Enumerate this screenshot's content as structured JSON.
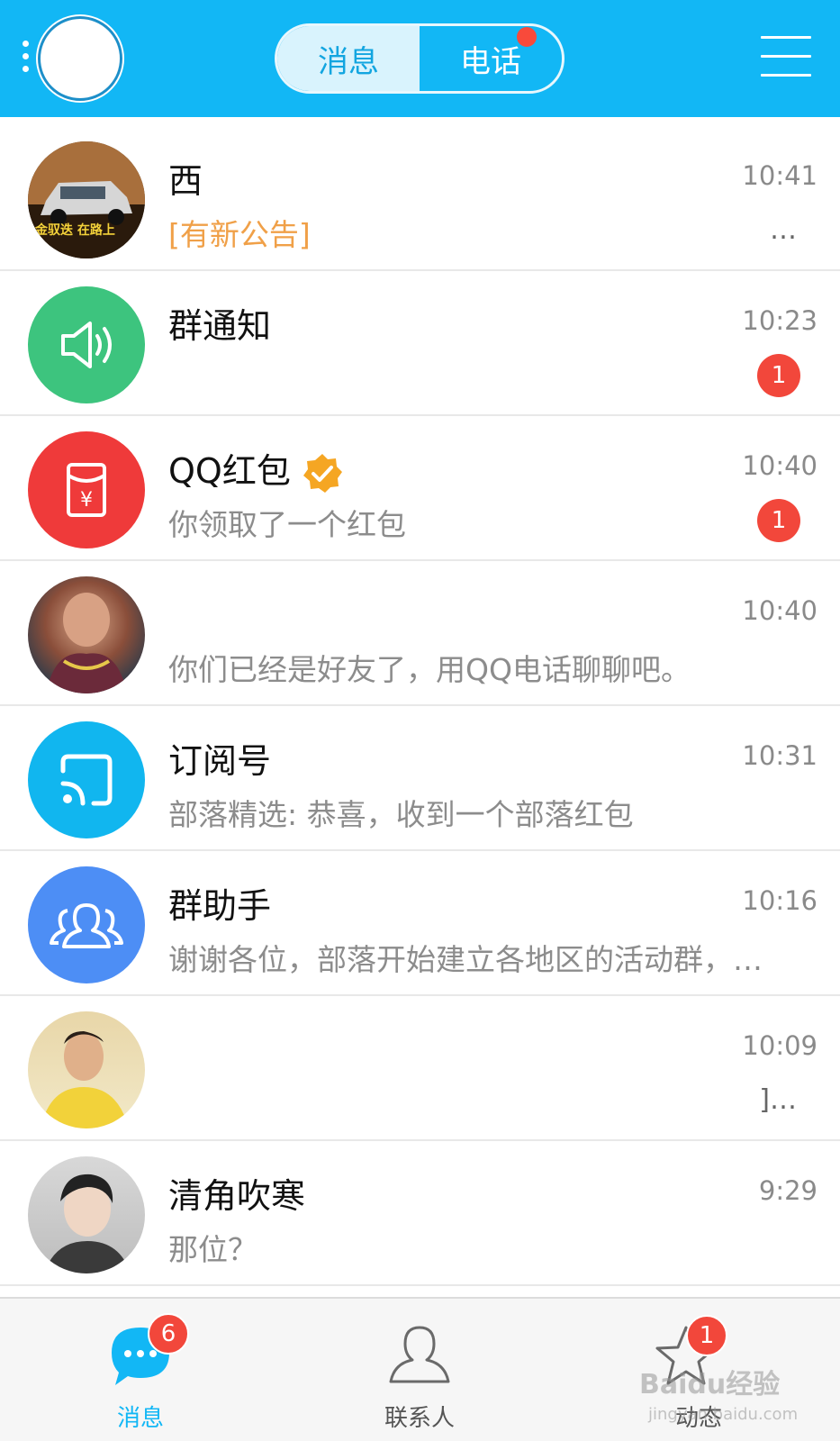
{
  "header": {
    "tabs": [
      {
        "label": "消息",
        "active": true
      },
      {
        "label": "电话",
        "active": false,
        "has_dot": true
      }
    ],
    "icons": [
      "more-dots-icon",
      "avatar",
      "menu-icon"
    ],
    "accent_color": "#12b7f5"
  },
  "conversations": [
    {
      "name": "西",
      "time": "10:41",
      "preview_tag": "[有新公告]",
      "preview": "",
      "trailing": "…",
      "avatar": "car-photo",
      "avatar_caption": "金驭迭 在路上"
    },
    {
      "name": "群通知",
      "time": "10:23",
      "preview": "",
      "badge": "1",
      "avatar": "speaker-icon"
    },
    {
      "name": "QQ红包",
      "time": "10:40",
      "preview": "你领取了一个红包",
      "badge": "1",
      "avatar": "red-envelope-icon",
      "verified": true
    },
    {
      "name": "",
      "time": "10:40",
      "preview": "你们已经是好友了，用QQ电话聊聊吧。",
      "avatar": "person-photo"
    },
    {
      "name": "订阅号",
      "time": "10:31",
      "preview": "部落精选: 恭喜，收到一个部落红包",
      "avatar": "rss-icon"
    },
    {
      "name": "群助手",
      "time": "10:16",
      "preview": "谢谢各位，部落开始建立各地区的活动群，…",
      "avatar": "group-icon"
    },
    {
      "name": "",
      "time": "10:09",
      "preview": "",
      "trailing": "]…",
      "avatar": "person-photo"
    },
    {
      "name": "清角吹寒",
      "time": "9:29",
      "preview": "那位？",
      "avatar": "person-photo"
    }
  ],
  "bottom_nav": [
    {
      "label": "消息",
      "badge": "6",
      "active": true
    },
    {
      "label": "联系人",
      "badge": "",
      "active": false
    },
    {
      "label": "动态",
      "badge": "1",
      "active": false
    }
  ],
  "watermark": {
    "text": "Baidu经验",
    "sub": "jingyan.baidu.com"
  }
}
